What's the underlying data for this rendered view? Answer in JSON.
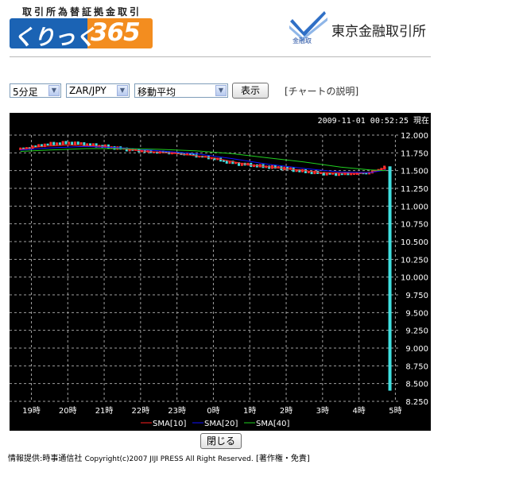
{
  "header": {
    "logo_kicker": "取引所為替証拠金取引",
    "logo_kana": "くりっく",
    "logo_number": "365",
    "exchange_mark_text": "金融取",
    "exchange_name": "東京金融取引所"
  },
  "controls": {
    "interval": "5分足",
    "pair": "ZAR/JPY",
    "indicator": "移動平均",
    "show_button": "表示",
    "help_link": "[チャートの説明]"
  },
  "chart_data": {
    "type": "candlestick",
    "timestamp": "2009-11-01 00:52:25 現在",
    "x_ticks": [
      "19時",
      "20時",
      "21時",
      "22時",
      "23時",
      "0時",
      "1時",
      "2時",
      "3時",
      "4時",
      "5時"
    ],
    "y_ticks": [
      "12.000",
      "11.750",
      "11.500",
      "11.250",
      "11.000",
      "10.750",
      "10.500",
      "10.250",
      "10.000",
      "9.750",
      "9.500",
      "9.250",
      "9.000",
      "8.750",
      "8.500",
      "8.250"
    ],
    "ylim": [
      8.25,
      12.0
    ],
    "grid": true,
    "price_path": [
      [
        18.7,
        11.8
      ],
      [
        19.0,
        11.83
      ],
      [
        19.3,
        11.86
      ],
      [
        19.6,
        11.88
      ],
      [
        20.0,
        11.89
      ],
      [
        20.3,
        11.88
      ],
      [
        20.6,
        11.86
      ],
      [
        21.0,
        11.84
      ],
      [
        21.3,
        11.82
      ],
      [
        21.6,
        11.8
      ],
      [
        22.0,
        11.78
      ],
      [
        22.3,
        11.76
      ],
      [
        22.6,
        11.76
      ],
      [
        23.0,
        11.74
      ],
      [
        23.3,
        11.73
      ],
      [
        23.6,
        11.7
      ],
      [
        24.0,
        11.67
      ],
      [
        24.3,
        11.63
      ],
      [
        24.6,
        11.6
      ],
      [
        25.0,
        11.58
      ],
      [
        25.3,
        11.56
      ],
      [
        25.6,
        11.55
      ],
      [
        26.0,
        11.53
      ],
      [
        26.3,
        11.5
      ],
      [
        26.6,
        11.48
      ],
      [
        27.0,
        11.46
      ],
      [
        27.3,
        11.45
      ],
      [
        27.6,
        11.45
      ],
      [
        28.0,
        11.46
      ],
      [
        28.3,
        11.47
      ],
      [
        28.55,
        11.52
      ],
      [
        28.75,
        11.56
      ],
      [
        28.85,
        8.4
      ]
    ],
    "series": [
      {
        "name": "SMA[10]",
        "color": "#ff2020",
        "points": [
          [
            18.7,
            11.8
          ],
          [
            19.3,
            11.84
          ],
          [
            20.0,
            11.86
          ],
          [
            21.0,
            11.84
          ],
          [
            22.0,
            11.78
          ],
          [
            23.0,
            11.74
          ],
          [
            24.0,
            11.68
          ],
          [
            25.0,
            11.58
          ],
          [
            26.0,
            11.53
          ],
          [
            27.0,
            11.47
          ],
          [
            28.0,
            11.46
          ],
          [
            28.4,
            11.48
          ],
          [
            28.75,
            11.54
          ]
        ]
      },
      {
        "name": "SMA[20]",
        "color": "#1010ff",
        "points": [
          [
            18.7,
            11.79
          ],
          [
            19.5,
            11.82
          ],
          [
            20.5,
            11.84
          ],
          [
            21.5,
            11.82
          ],
          [
            22.5,
            11.78
          ],
          [
            23.5,
            11.74
          ],
          [
            24.5,
            11.67
          ],
          [
            25.5,
            11.59
          ],
          [
            26.5,
            11.53
          ],
          [
            27.5,
            11.48
          ],
          [
            28.3,
            11.47
          ],
          [
            28.75,
            11.51
          ]
        ]
      },
      {
        "name": "SMA[40]",
        "color": "#20d020",
        "points": [
          [
            18.7,
            11.77
          ],
          [
            19.5,
            11.79
          ],
          [
            20.5,
            11.81
          ],
          [
            21.5,
            11.81
          ],
          [
            22.5,
            11.8
          ],
          [
            23.5,
            11.78
          ],
          [
            24.5,
            11.74
          ],
          [
            25.5,
            11.68
          ],
          [
            26.5,
            11.62
          ],
          [
            27.5,
            11.55
          ],
          [
            28.3,
            11.51
          ],
          [
            28.75,
            11.5
          ]
        ]
      }
    ]
  },
  "close_button": "閉じる",
  "footer": {
    "source": "情報提供:時事通信社",
    "copyright": "Copyright(c)2007 JIJI PRESS All Right Reserved.",
    "terms_link": "[著作権・免責]"
  }
}
